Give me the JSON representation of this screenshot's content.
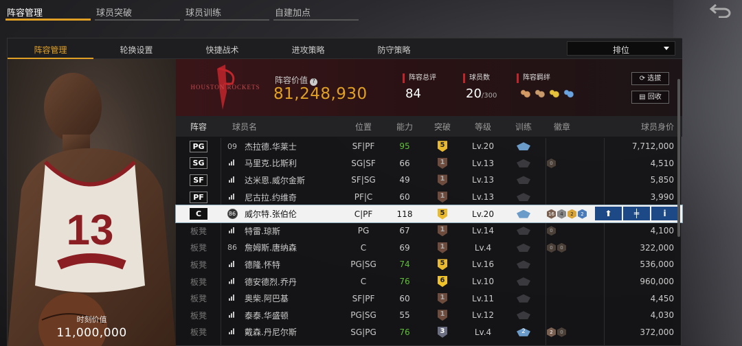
{
  "top_tabs": [
    "阵容管理",
    "球员突破",
    "球员训练",
    "自建加点"
  ],
  "sub_tabs": [
    "阵容管理",
    "轮换设置",
    "快捷战术",
    "进攻策略",
    "防守策略"
  ],
  "sort_select": "排位",
  "portrait": {
    "label": "时刻价值",
    "value": "11,000,000"
  },
  "team_logo_text": "HOUSTON ROCKETS",
  "summary": {
    "lineup_value_label": "阵容价值",
    "lineup_value": "81,248,930",
    "rating_label": "阵容总评",
    "rating": "84",
    "count_label": "球员数",
    "count": "20",
    "count_max": "/300",
    "bond_label": "阵容羁绊",
    "select_button": "选拔",
    "recycle_button": "回收"
  },
  "table_headers": [
    "阵容",
    "球员名",
    "位置",
    "能力",
    "突破",
    "等级",
    "训练",
    "徽章",
    "球员身价"
  ],
  "rows": [
    {
      "slot": "PG",
      "num": "09",
      "name": "杰拉德.华莱士",
      "pos": "SF|PF",
      "ability": "95",
      "ability_green": true,
      "break": "5",
      "level": "Lv.20",
      "train_on": true,
      "badges": [],
      "price": "7,712,000"
    },
    {
      "slot": "SG",
      "num": "",
      "name": "马里克.比斯利",
      "pos": "SG|SF",
      "ability": "66",
      "ability_green": false,
      "break": "1",
      "level": "Lv.13",
      "train_on": false,
      "badges": [
        "0"
      ],
      "price": "4,510"
    },
    {
      "slot": "SF",
      "num": "",
      "name": "达米恩.威尔金斯",
      "pos": "SF|SG",
      "ability": "49",
      "ability_green": false,
      "break": "1",
      "level": "Lv.13",
      "train_on": false,
      "badges": [],
      "price": "5,850"
    },
    {
      "slot": "PF",
      "num": "",
      "name": "尼古拉.约维奇",
      "pos": "PF|C",
      "ability": "60",
      "ability_green": false,
      "break": "1",
      "level": "Lv.13",
      "train_on": false,
      "badges": [],
      "price": "3,990"
    },
    {
      "slot": "C",
      "num": "86",
      "name": "威尔特.张伯伦",
      "pos": "C|PF",
      "ability": "118",
      "ability_green": false,
      "break": "5",
      "level": "Lv.20",
      "train_on": true,
      "badges": [
        "16",
        "4",
        "2",
        "2"
      ],
      "price": "",
      "selected": true
    },
    {
      "slot": "板凳",
      "num": "",
      "name": "特雷.琼斯",
      "pos": "PG",
      "ability": "67",
      "ability_green": false,
      "break": "1",
      "level": "Lv.14",
      "train_on": false,
      "badges": [
        "0"
      ],
      "price": "4,100"
    },
    {
      "slot": "板凳",
      "num": "86",
      "name": "詹姆斯.唐纳森",
      "pos": "C",
      "ability": "69",
      "ability_green": false,
      "break": "1",
      "level": "Lv.4",
      "train_on": false,
      "badges": [
        "0",
        "0"
      ],
      "price": "322,000"
    },
    {
      "slot": "板凳",
      "num": "",
      "name": "德隆.怀特",
      "pos": "PG|SG",
      "ability": "74",
      "ability_green": true,
      "break": "5",
      "level": "Lv.16",
      "train_on": false,
      "badges": [],
      "price": "536,000"
    },
    {
      "slot": "板凳",
      "num": "",
      "name": "德安德烈.乔丹",
      "pos": "C",
      "ability": "76",
      "ability_green": true,
      "break": "6",
      "level": "Lv.10",
      "train_on": false,
      "badges": [],
      "price": "960,000"
    },
    {
      "slot": "板凳",
      "num": "",
      "name": "奥柴.阿巴基",
      "pos": "SF|PF",
      "ability": "60",
      "ability_green": false,
      "break": "1",
      "level": "Lv.11",
      "train_on": false,
      "badges": [],
      "price": "4,450"
    },
    {
      "slot": "板凳",
      "num": "",
      "name": "泰泰.华盛顿",
      "pos": "PG|SG",
      "ability": "55",
      "ability_green": false,
      "break": "1",
      "level": "Lv.12",
      "train_on": false,
      "badges": [],
      "price": "4,030"
    },
    {
      "slot": "板凳",
      "num": "",
      "name": "戴森.丹尼尔斯",
      "pos": "SG|PG",
      "ability": "76",
      "ability_green": true,
      "break": "3",
      "level": "Lv.4",
      "train_on": true,
      "train_num": "2",
      "badges": [
        "2",
        "0"
      ],
      "price": "372,000"
    }
  ],
  "colors": {
    "accent": "#e0a026",
    "header_red": "#c0252b",
    "select_blue": "#1d4a86"
  }
}
